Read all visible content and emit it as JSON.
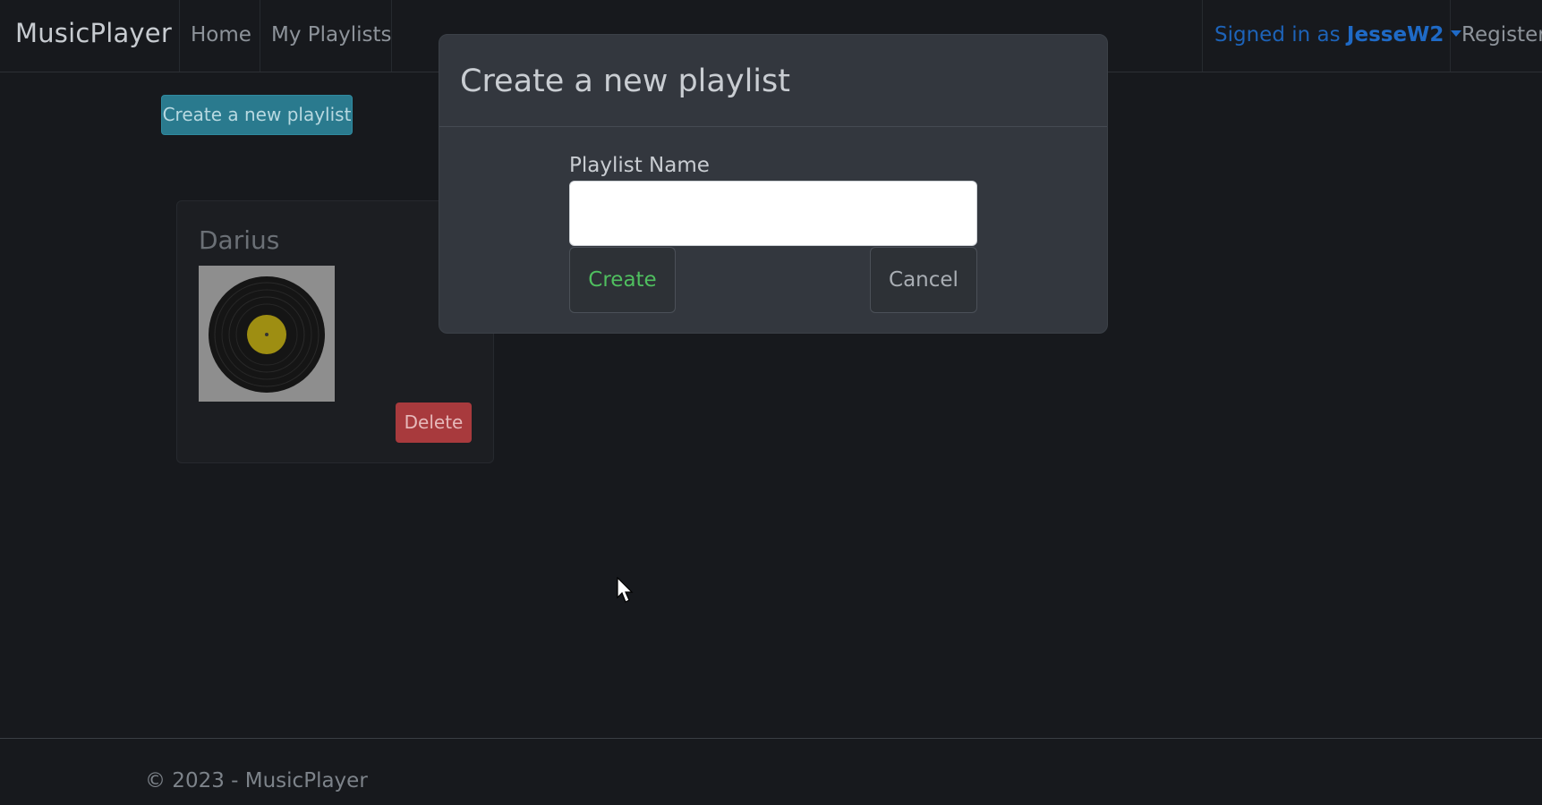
{
  "navbar": {
    "brand": "MusicPlayer",
    "links": [
      {
        "label": "Home"
      },
      {
        "label": "My Playlists"
      }
    ],
    "user": {
      "prefix": "Signed in as ",
      "username": "JesseW2"
    },
    "register_label": "Register",
    "accent_color": "#1f6ac6"
  },
  "main": {
    "create_button_label": "Create a new playlist",
    "playlists": [
      {
        "name": "Darius",
        "cover_icon": "vinyl-record-icon",
        "delete_label": "Delete"
      }
    ]
  },
  "modal": {
    "title": "Create a new playlist",
    "field_label": "Playlist Name",
    "field_value": "",
    "field_placeholder": "",
    "create_label": "Create",
    "cancel_label": "Cancel"
  },
  "footer": {
    "text": "© 2023 - MusicPlayer"
  },
  "colors": {
    "background": "#17191d",
    "primary_button": "#2a7a8e",
    "danger_button": "#a83a3d",
    "success_text": "#4fbf5f"
  }
}
